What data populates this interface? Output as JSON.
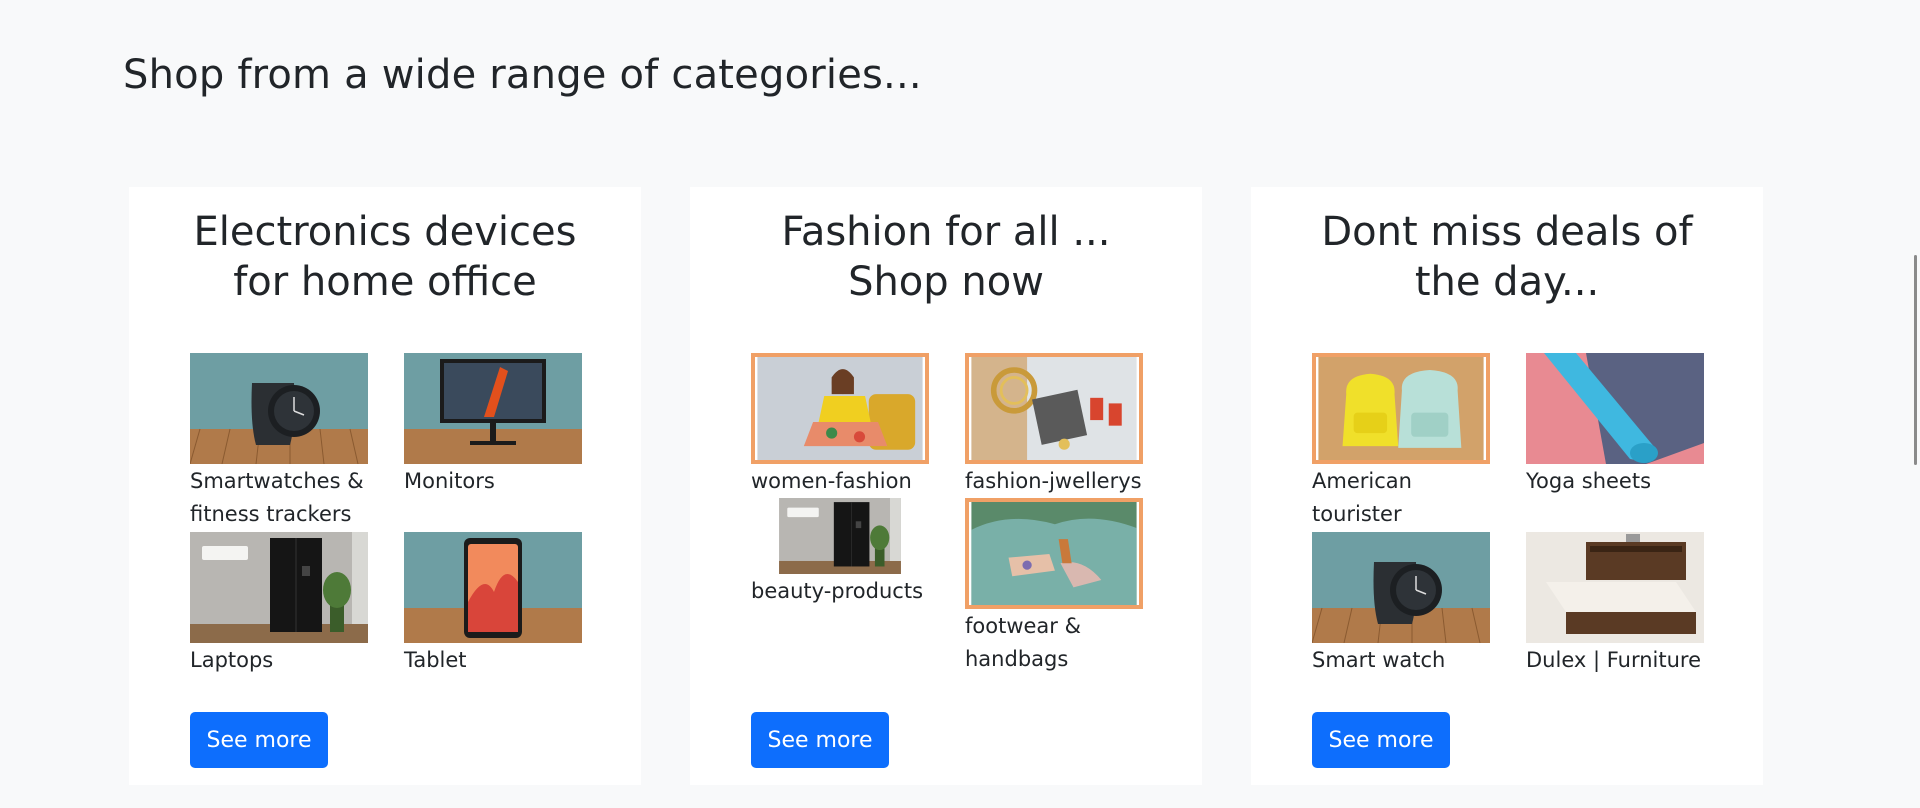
{
  "page": {
    "heading": "Shop from a wide range of categories..."
  },
  "cards": [
    {
      "title": "Electronics devices for home office",
      "items": [
        {
          "label": "Smartwatches & fitness trackers",
          "image": "smartwatch-image"
        },
        {
          "label": "Monitors",
          "image": "monitor-image"
        },
        {
          "label": "Laptops",
          "image": "refrigerator-image"
        },
        {
          "label": "Tablet",
          "image": "tablet-image"
        }
      ],
      "button": "See more"
    },
    {
      "title": "Fashion for all ... Shop now",
      "items": [
        {
          "label": "women-fashion",
          "image": "women-fashion-image"
        },
        {
          "label": "fashion-jwellerys",
          "image": "jewellery-image"
        },
        {
          "label": "beauty-products",
          "image": "refrigerator-image"
        },
        {
          "label": "footwear & handbags",
          "image": "footwear-image"
        }
      ],
      "button": "See more"
    },
    {
      "title": "Dont miss deals of the day...",
      "items": [
        {
          "label": "American tourister",
          "image": "backpack-image"
        },
        {
          "label": "Yoga sheets",
          "image": "yoga-mat-image"
        },
        {
          "label": "Smart watch",
          "image": "smartwatch-image"
        },
        {
          "label": "Dulex | Furniture",
          "image": "bed-image"
        }
      ],
      "button": "See more"
    }
  ],
  "colors": {
    "background": "#f8f9fa",
    "card": "#ffffff",
    "button": "#0d6efd",
    "image_frame": "#f0a066"
  }
}
